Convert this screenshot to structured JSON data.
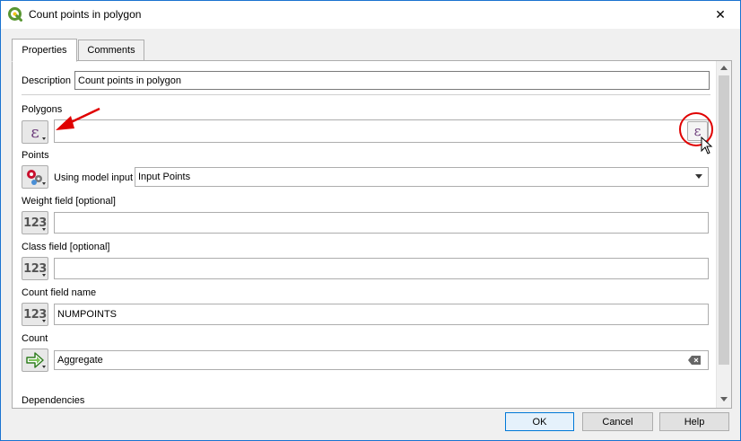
{
  "window": {
    "title": "Count points in polygon",
    "close_glyph": "✕"
  },
  "tabs": [
    {
      "label": "Properties",
      "active": true
    },
    {
      "label": "Comments",
      "active": false
    }
  ],
  "description": {
    "label": "Description",
    "value": "Count points in polygon"
  },
  "polygons": {
    "label": "Polygons",
    "value": "",
    "expression_glyph": "ε"
  },
  "points": {
    "label": "Points",
    "source_label": "Using model input",
    "value": "Input Points"
  },
  "weight_field": {
    "label": "Weight field [optional]",
    "value": "",
    "icon_text": "123"
  },
  "class_field": {
    "label": "Class field [optional]",
    "value": "",
    "icon_text": "123"
  },
  "count_field_name": {
    "label": "Count field name",
    "value": "NUMPOINTS",
    "icon_text": "123"
  },
  "count": {
    "label": "Count",
    "value": "Aggregate"
  },
  "dependencies": {
    "label": "Dependencies"
  },
  "buttons": {
    "ok": "OK",
    "cancel": "Cancel",
    "help": "Help"
  },
  "colors": {
    "accent": "#0078d7",
    "annotation_red": "#e00000",
    "qgis_green": "#589632"
  },
  "icons": {
    "app": "qgis-logo-icon",
    "close": "close-icon",
    "expression": "expression-epsilon-icon",
    "model_input": "model-input-gears-icon",
    "numeric": "numeric-123-icon",
    "output": "output-arrow-icon",
    "clear": "clear-text-icon",
    "cursor": "mouse-pointer-icon"
  }
}
